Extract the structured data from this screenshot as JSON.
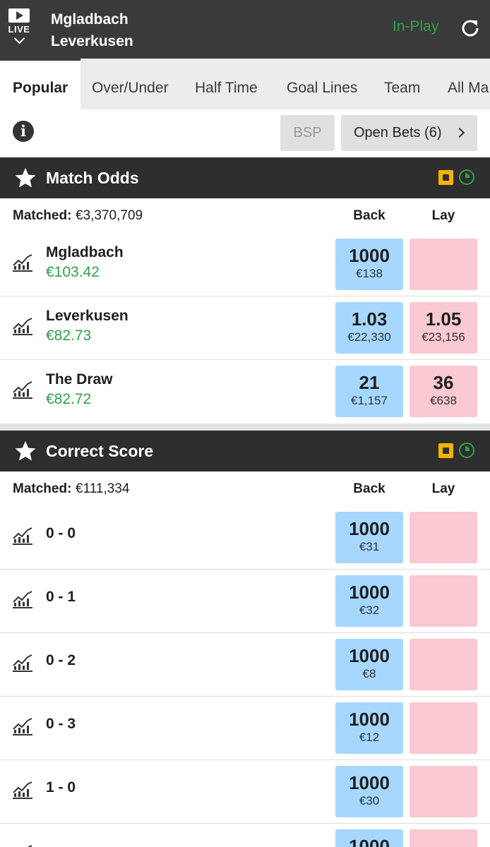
{
  "header": {
    "live_label": "LIVE",
    "team_home": "Mgladbach",
    "team_away": "Leverkusen",
    "status": "In-Play",
    "status_color": "#2ea24a"
  },
  "tabs": [
    "Popular",
    "Over/Under",
    "Half Time",
    "Goal Lines",
    "Team",
    "All Ma"
  ],
  "controls": {
    "bsp_label": "BSP",
    "open_bets_label": "Open Bets (6)"
  },
  "markets": [
    {
      "title": "Match Odds",
      "matched_label": "Matched:",
      "matched_value": "€3,370,709",
      "back_label": "Back",
      "lay_label": "Lay",
      "runners": [
        {
          "name": "Mgladbach",
          "pl": "€103.42",
          "back_price": "1000",
          "back_size": "€138",
          "lay_price": "",
          "lay_size": ""
        },
        {
          "name": "Leverkusen",
          "pl": "€82.73",
          "back_price": "1.03",
          "back_size": "€22,330",
          "lay_price": "1.05",
          "lay_size": "€23,156"
        },
        {
          "name": "The Draw",
          "pl": "€82.72",
          "back_price": "21",
          "back_size": "€1,157",
          "lay_price": "36",
          "lay_size": "€638"
        }
      ]
    },
    {
      "title": "Correct Score",
      "matched_label": "Matched:",
      "matched_value": "€111,334",
      "back_label": "Back",
      "lay_label": "Lay",
      "runners": [
        {
          "name": "0 - 0",
          "back_price": "1000",
          "back_size": "€31",
          "lay_price": "",
          "lay_size": ""
        },
        {
          "name": "0 - 1",
          "back_price": "1000",
          "back_size": "€32",
          "lay_price": "",
          "lay_size": ""
        },
        {
          "name": "0 - 2",
          "back_price": "1000",
          "back_size": "€8",
          "lay_price": "",
          "lay_size": ""
        },
        {
          "name": "0 - 3",
          "back_price": "1000",
          "back_size": "€12",
          "lay_price": "",
          "lay_size": ""
        },
        {
          "name": "1 - 0",
          "back_price": "1000",
          "back_size": "€30",
          "lay_price": "",
          "lay_size": ""
        },
        {
          "name": "",
          "back_price": "1000",
          "back_size": "",
          "lay_price": "",
          "lay_size": ""
        }
      ]
    }
  ]
}
